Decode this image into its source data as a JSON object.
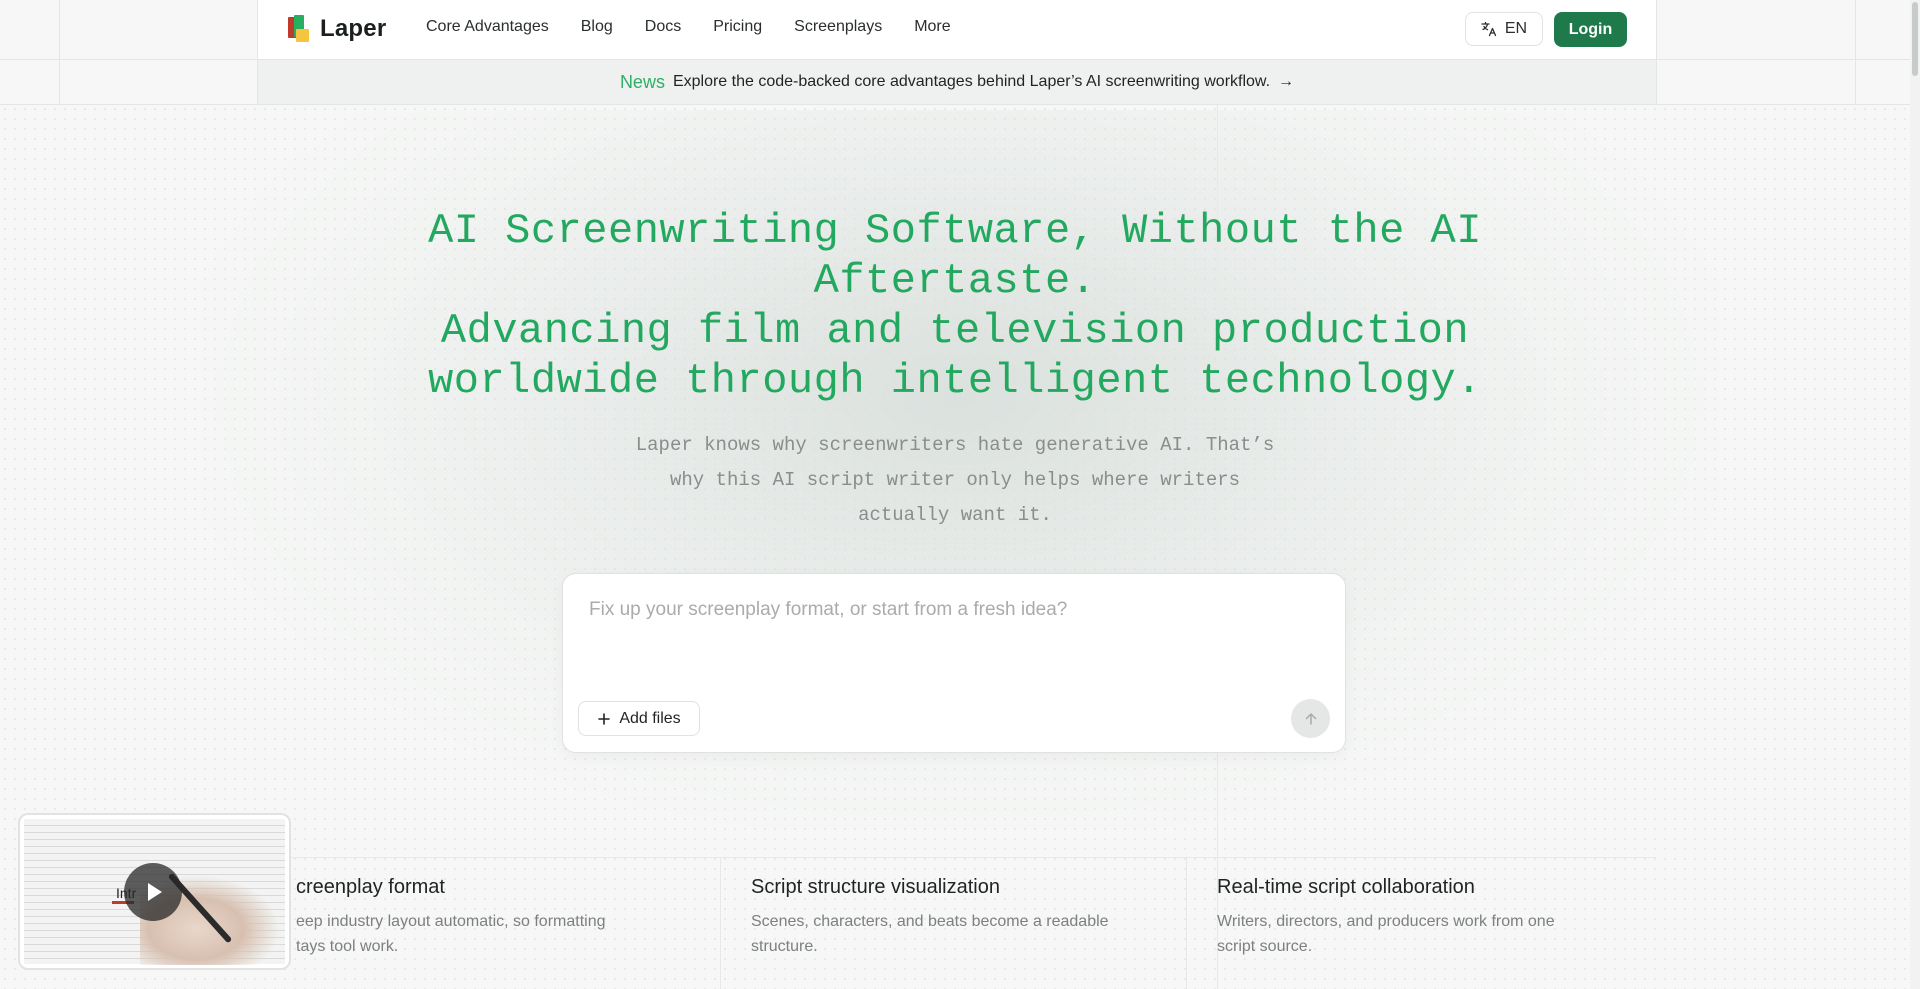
{
  "brand": {
    "name": "Laper"
  },
  "nav": {
    "items": [
      "Core Advantages",
      "Blog",
      "Docs",
      "Pricing",
      "Screenplays",
      "More"
    ],
    "language": "EN",
    "login": "Login"
  },
  "news": {
    "tag": "News",
    "text": "Explore the code-backed core advantages behind Laper’s AI screenwriting workflow.",
    "arrow": "→"
  },
  "hero": {
    "title_lines": [
      "AI Screenwriting Software, Without the AI",
      "Aftertaste.",
      "Advancing film and television production",
      "worldwide through intelligent technology."
    ],
    "subtitle_lines": [
      "Laper knows why screenwriters hate generative AI. That’s",
      "why this AI script writer only helps where writers",
      "actually want it."
    ]
  },
  "prompt": {
    "placeholder": "Fix up your screenplay format, or start from a fresh idea?",
    "value": "",
    "add_files": "Add files"
  },
  "features": [
    {
      "title": "creenplay format",
      "desc_lines": [
        "eep industry layout automatic, so formatting",
        "tays tool work."
      ]
    },
    {
      "title": "Script structure visualization",
      "desc_lines": [
        "Scenes, characters, and beats become a readable",
        "structure."
      ]
    },
    {
      "title": "Real-time script collaboration",
      "desc_lines": [
        "Writers, directors, and producers work from one",
        "script source."
      ]
    }
  ],
  "video": {
    "label": "Intr"
  },
  "colors": {
    "accent": "#22a85f",
    "login_bg": "#1e7a4a",
    "news_tag": "#2fae66"
  }
}
